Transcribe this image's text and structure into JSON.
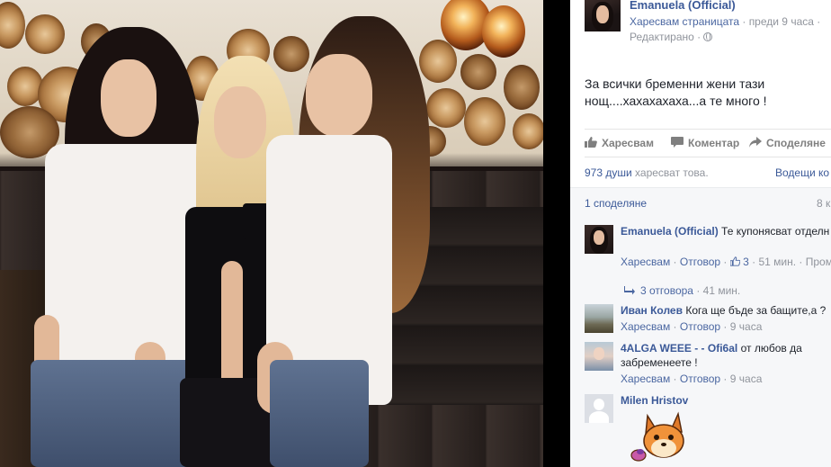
{
  "post": {
    "page_name": "Emanuela (Official)",
    "liked_page": "Харесвам страницата",
    "time": "преди 9 часа",
    "edited": "Редактирано",
    "text": "За всички бременни жени тази нощ....хахахахаха...а те много !"
  },
  "actions": {
    "like": "Харесвам",
    "comment": "Коментар",
    "share": "Споделяне"
  },
  "stats": {
    "likes_count": "973 души",
    "likes_suffix": "харесват това.",
    "top_comments": "Водещи ко",
    "shares": "1 споделяне",
    "shares_right": "8 к"
  },
  "comments": [
    {
      "author": "Emanuela (Official)",
      "text": "Те купонясват отделн Хахахахаха",
      "like": "Харесвам",
      "reply": "Отговор",
      "like_count": "3",
      "time": "51 мин.",
      "extra": "Пром",
      "replies": "3 отговора",
      "replies_time": "41 мин."
    },
    {
      "author": "Иван Колев",
      "text": "Кога ще бъде за бащите,а ?",
      "like": "Харесвам",
      "reply": "Отговор",
      "time": "9 часа"
    },
    {
      "author": "4ALGA WEEE - - Ofi6al",
      "text": "от любов да забременеете !",
      "like": "Харесвам",
      "reply": "Отговор",
      "time": "9 часа"
    },
    {
      "author": "Milen Hristov"
    }
  ],
  "icons": {
    "globe": "globe-icon",
    "like": "thumbs-up-icon",
    "comment": "speech-bubble-icon",
    "share": "share-arrow-icon",
    "reply_arrow": "reply-arrow-icon",
    "sticker": "fox-sticker-icon"
  },
  "colors": {
    "link_blue": "#3b5998",
    "meta_gray": "#90949c",
    "action_gray": "#7f7f7f"
  }
}
